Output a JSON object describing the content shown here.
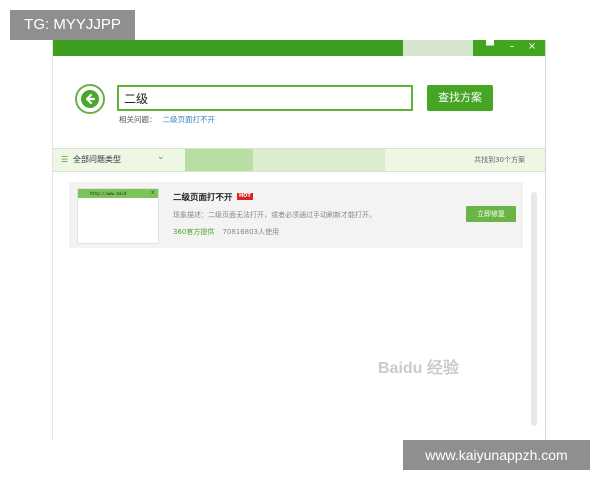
{
  "overlay": {
    "top_tag": "TG: MYYJJPP",
    "bottom_tag": "www.kaiyunappzh.com",
    "watermark": "Baidu 经验"
  },
  "window": {
    "controls": {
      "menu": "▀",
      "minimize": "–",
      "close": "×"
    }
  },
  "search": {
    "value": "二级",
    "button_label": "查找方案",
    "related_label": "相关问题：",
    "related_link": "二级页面打不开"
  },
  "filter": {
    "label": "全部问题类型",
    "count_text": "共找到30个方案"
  },
  "results": [
    {
      "title": "二级页面打不开",
      "badge": "HOT",
      "description": "现象描述：二级页面无法打开，或者必须通过手动刷新才能打开。",
      "provider": "360官方提供",
      "users": "70816803人使用",
      "action_label": "立即修复",
      "thumb_url": "http://www.baid",
      "thumb_close": "×"
    }
  ],
  "colors": {
    "brand_green": "#46a523",
    "hot_red": "#d9261c",
    "link_blue": "#3a84c4"
  },
  "icons": [
    "back-arrow-icon",
    "filter-list-icon",
    "chevron-down-icon"
  ]
}
